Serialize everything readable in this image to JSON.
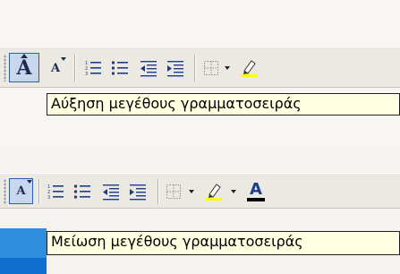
{
  "toolbar_top": {
    "buttons": [
      {
        "name": "grow-font-button",
        "icon": "grow-font-icon",
        "pressed": true
      },
      {
        "name": "shrink-font-button",
        "icon": "shrink-font-icon"
      },
      {
        "name": "numbering-button",
        "icon": "numbered-list-icon"
      },
      {
        "name": "bullets-button",
        "icon": "bulleted-list-icon"
      },
      {
        "name": "decrease-indent-button",
        "icon": "decrease-indent-icon"
      },
      {
        "name": "increase-indent-button",
        "icon": "increase-indent-icon"
      },
      {
        "name": "borders-button",
        "icon": "borders-icon"
      },
      {
        "name": "highlight-button",
        "icon": "highlight-pen-icon"
      }
    ]
  },
  "tooltip_top": {
    "text": "Αύξηση μεγέθους γραμματοσειράς"
  },
  "toolbar_bottom": {
    "buttons": [
      {
        "name": "shrink-font-button",
        "icon": "shrink-font-icon",
        "pressed": true
      },
      {
        "name": "numbering-button",
        "icon": "numbered-list-icon"
      },
      {
        "name": "bullets-button",
        "icon": "bulleted-list-icon"
      },
      {
        "name": "decrease-indent-button",
        "icon": "decrease-indent-icon"
      },
      {
        "name": "increase-indent-button",
        "icon": "increase-indent-icon"
      },
      {
        "name": "borders-button",
        "icon": "borders-icon"
      },
      {
        "name": "highlight-button",
        "icon": "highlight-pen-icon"
      },
      {
        "name": "font-color-button",
        "icon": "font-color-icon"
      }
    ],
    "font_color_letter": "A"
  },
  "tooltip_bottom": {
    "text": "Μείωση μεγέθους γραμματοσειράς"
  },
  "colors": {
    "highlight": "#ffff00",
    "font_color": "#000000",
    "accent": "#2c5fb0"
  }
}
